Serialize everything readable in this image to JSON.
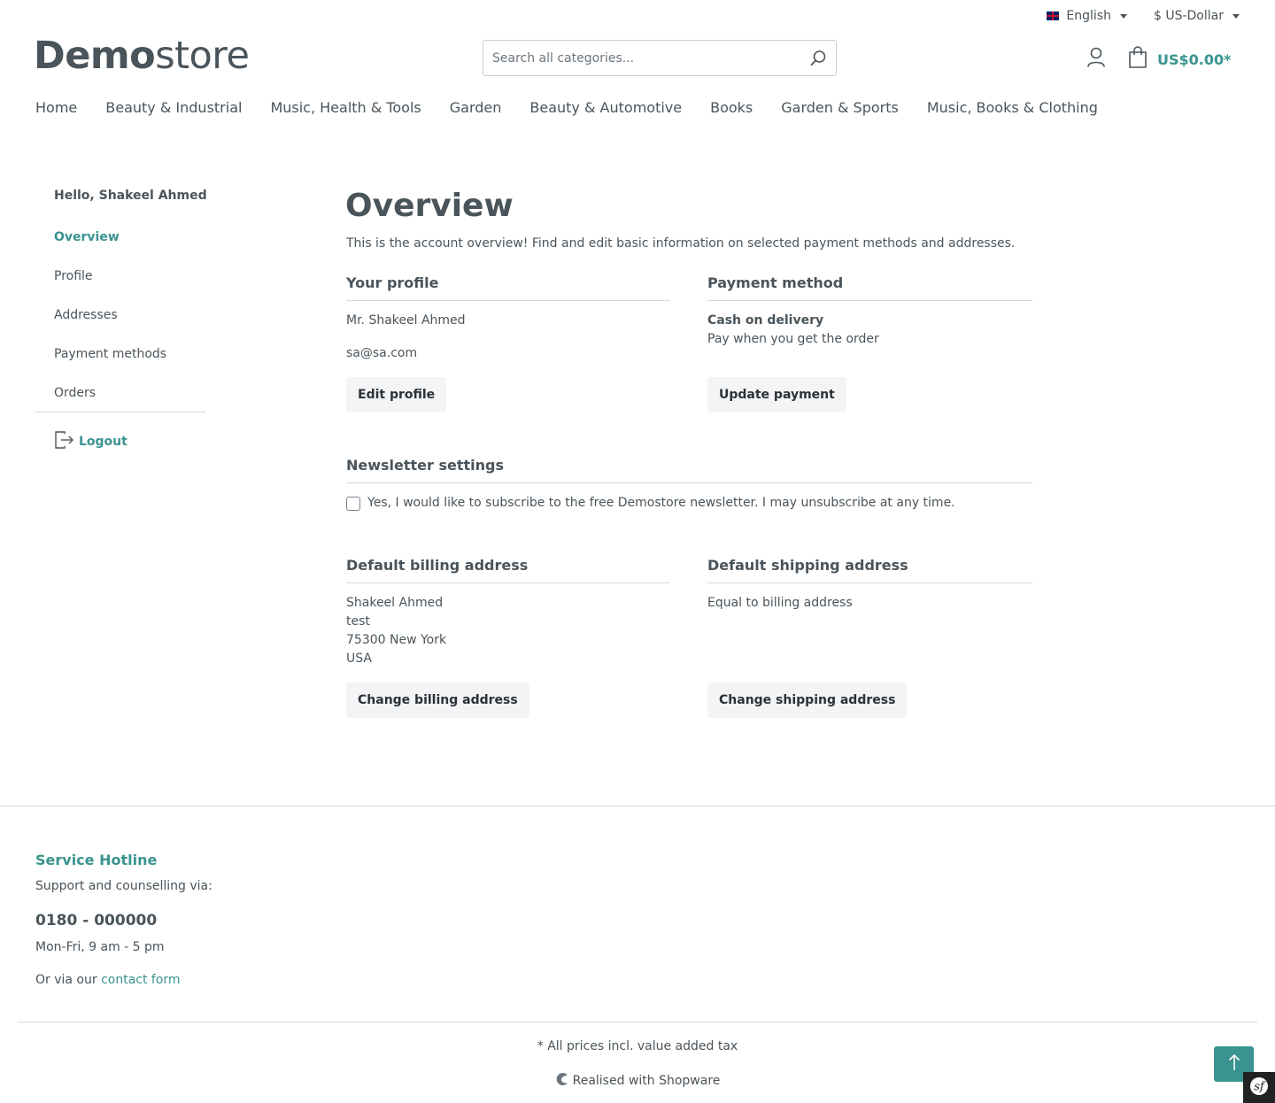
{
  "topbar": {
    "language": "English",
    "currency": "$ US-Dollar"
  },
  "logo": {
    "bold": "Demo",
    "light": "store"
  },
  "search": {
    "placeholder": "Search all categories..."
  },
  "cart": {
    "total": "US$0.00*"
  },
  "nav": [
    "Home",
    "Beauty & Industrial",
    "Music, Health & Tools",
    "Garden",
    "Beauty & Automotive",
    "Books",
    "Garden & Sports",
    "Music, Books & Clothing"
  ],
  "sidebar": {
    "greeting": "Hello, Shakeel Ahmed",
    "items": [
      "Overview",
      "Profile",
      "Addresses",
      "Payment methods",
      "Orders"
    ],
    "logout": "Logout"
  },
  "overview": {
    "title": "Overview",
    "intro": "This is the account overview! Find and edit basic information on selected payment methods and addresses."
  },
  "profile": {
    "title": "Your profile",
    "name": "Mr. Shakeel Ahmed",
    "email": "sa@sa.com",
    "button": "Edit profile"
  },
  "payment": {
    "title": "Payment method",
    "method": "Cash on delivery",
    "description": "Pay when you get the order",
    "button": "Update payment"
  },
  "newsletter": {
    "title": "Newsletter settings",
    "label": "Yes, I would like to subscribe to the free Demostore newsletter. I may unsubscribe at any time."
  },
  "billing": {
    "title": "Default billing address",
    "lines": [
      "Shakeel Ahmed",
      "test",
      "75300 New York",
      "USA"
    ],
    "button": "Change billing address"
  },
  "shipping": {
    "title": "Default shipping address",
    "text": "Equal to billing address",
    "button": "Change shipping address"
  },
  "footer": {
    "hotline_title": "Service Hotline",
    "support_text": "Support and counselling via:",
    "phone": "0180 - 000000",
    "hours": "Mon-Fri, 9 am - 5 pm",
    "contact_prefix": "Or via our",
    "contact_link": "contact form",
    "tax_note": "* All prices incl. value added tax",
    "realised": "Realised with Shopware"
  },
  "colors": {
    "accent": "#3a9390",
    "text": "#4a545b",
    "button_bg": "#f3f4f5"
  }
}
